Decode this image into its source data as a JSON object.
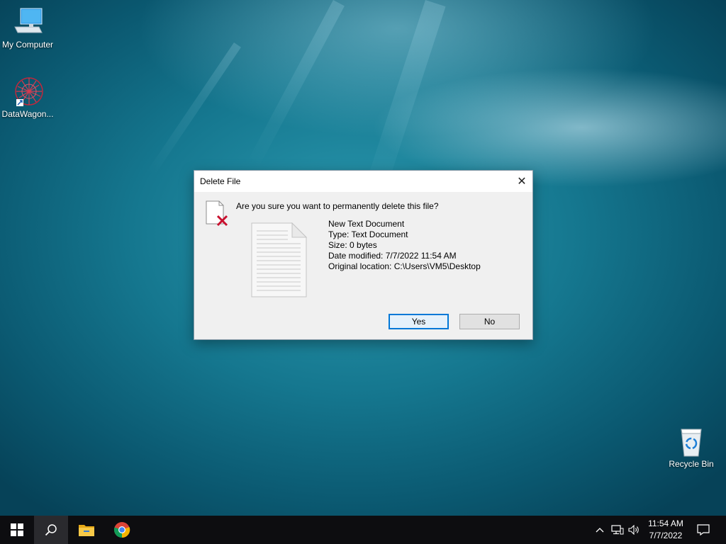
{
  "desktop": {
    "icons": [
      {
        "label": "My Computer",
        "icon": "computer-icon"
      },
      {
        "label": "DataWagon...",
        "icon": "datawagon-icon"
      },
      {
        "label": "Recycle Bin",
        "icon": "recycle-bin-icon"
      }
    ]
  },
  "dialog": {
    "title": "Delete File",
    "question": "Are you sure you want to permanently delete this file?",
    "file_name": "New Text Document",
    "file_type": "Type: Text Document",
    "file_size": "Size: 0 bytes",
    "date_modified": "Date modified: 7/7/2022 11:54 AM",
    "original_location": "Original location: C:\\Users\\VM5\\Desktop",
    "yes_label": "Yes",
    "no_label": "No",
    "close_icon": "close-icon"
  },
  "taskbar": {
    "pinned": [
      "windows-start-icon",
      "search-icon",
      "file-explorer-icon",
      "chrome-icon"
    ],
    "tray_icons": [
      "chevron-up-icon",
      "network-icon",
      "volume-icon"
    ],
    "time": "11:54 AM",
    "date": "7/7/2022",
    "notifications_icon": "notification-icon"
  },
  "colors": {
    "accent": "#0078d7",
    "taskbar": "#0d0d10",
    "dialog_bg": "#f0f0f0"
  }
}
